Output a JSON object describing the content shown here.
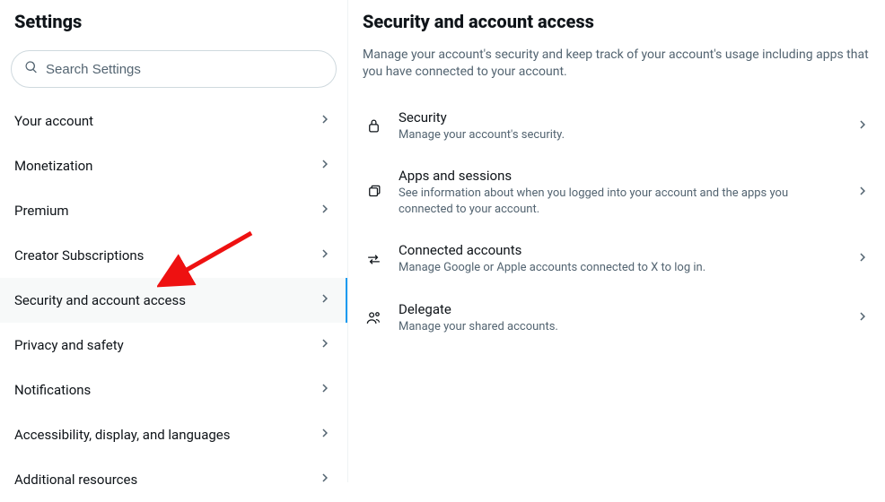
{
  "sidebar": {
    "title": "Settings",
    "search_placeholder": "Search Settings",
    "items": [
      {
        "label": "Your account",
        "active": false
      },
      {
        "label": "Monetization",
        "active": false
      },
      {
        "label": "Premium",
        "active": false
      },
      {
        "label": "Creator Subscriptions",
        "active": false
      },
      {
        "label": "Security and account access",
        "active": true
      },
      {
        "label": "Privacy and safety",
        "active": false
      },
      {
        "label": "Notifications",
        "active": false
      },
      {
        "label": "Accessibility, display, and languages",
        "active": false
      },
      {
        "label": "Additional resources",
        "active": false
      }
    ]
  },
  "main": {
    "title": "Security and account access",
    "subtitle": "Manage your account's security and keep track of your account's usage including apps that you have connected to your account.",
    "items": [
      {
        "icon": "lock",
        "title": "Security",
        "desc": "Manage your account's security."
      },
      {
        "icon": "apps",
        "title": "Apps and sessions",
        "desc": "See information about when you logged into your account and the apps you connected to your account."
      },
      {
        "icon": "swap",
        "title": "Connected accounts",
        "desc": "Manage Google or Apple accounts connected to X to log in."
      },
      {
        "icon": "people",
        "title": "Delegate",
        "desc": "Manage your shared accounts."
      }
    ]
  }
}
